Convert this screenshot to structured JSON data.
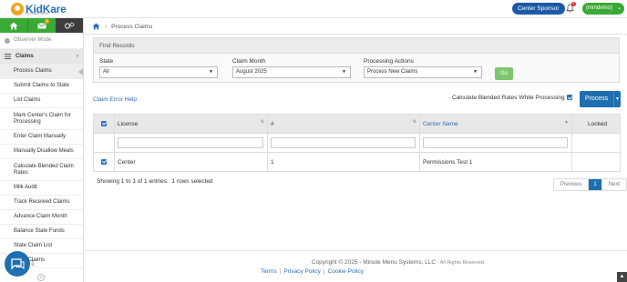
{
  "header": {
    "logo_text": "KidKare",
    "logo_sub": "by Minute Menu",
    "sponsor_button": "Center Sponsor",
    "notif_count": "1",
    "user_label": "(mmdemo)"
  },
  "sidebar": {
    "mail_count": "1",
    "observer_mode": "Observer Mode",
    "claims_label": "Claims",
    "items": [
      "Process Claims",
      "Submit Claims to State",
      "List Claims",
      "Mark Center's Claim for Processing",
      "Enter Claim Manually",
      "Manually Disallow Meals",
      "Calculate Blended Claim Rates",
      "Milk Audit",
      "Track Received Claims",
      "Advance Claim Month",
      "Balance State Funds",
      "State Claim List",
      "State Claims"
    ]
  },
  "breadcrumb": {
    "current": "Process Claims"
  },
  "find": {
    "title": "Find Records",
    "state_label": "State",
    "state_value": "All",
    "month_label": "Claim Month",
    "month_value": "August 2025",
    "action_label": "Processing Actions",
    "action_value": "Process New Claims",
    "go_label": "Go"
  },
  "claim_error_help": "Claim Error Help",
  "blended_label": "Calculate Blended Rates While Processing",
  "process_label": "Process",
  "table": {
    "headers": [
      "License",
      "#",
      "Center Name",
      "Locked"
    ],
    "rows": [
      {
        "license": "Center",
        "num": "1",
        "center_name": "Permissions Test 1",
        "locked": ""
      }
    ]
  },
  "showing": "Showing 1 to 1 of 1 entries.  1 rows selected",
  "pager": {
    "prev": "Previous",
    "page": "1",
    "next": "Next"
  },
  "footer": {
    "copyright": "Copyright © 2025 - Minute Menu Systems, LLC",
    "rights": " - All Rights Reserved",
    "terms": "Terms",
    "privacy": "Privacy Policy",
    "cookie": "Cookie Policy"
  },
  "colors": {
    "primary": "#1f6fb0",
    "green": "#3aa935",
    "accent": "#f2a31b"
  }
}
